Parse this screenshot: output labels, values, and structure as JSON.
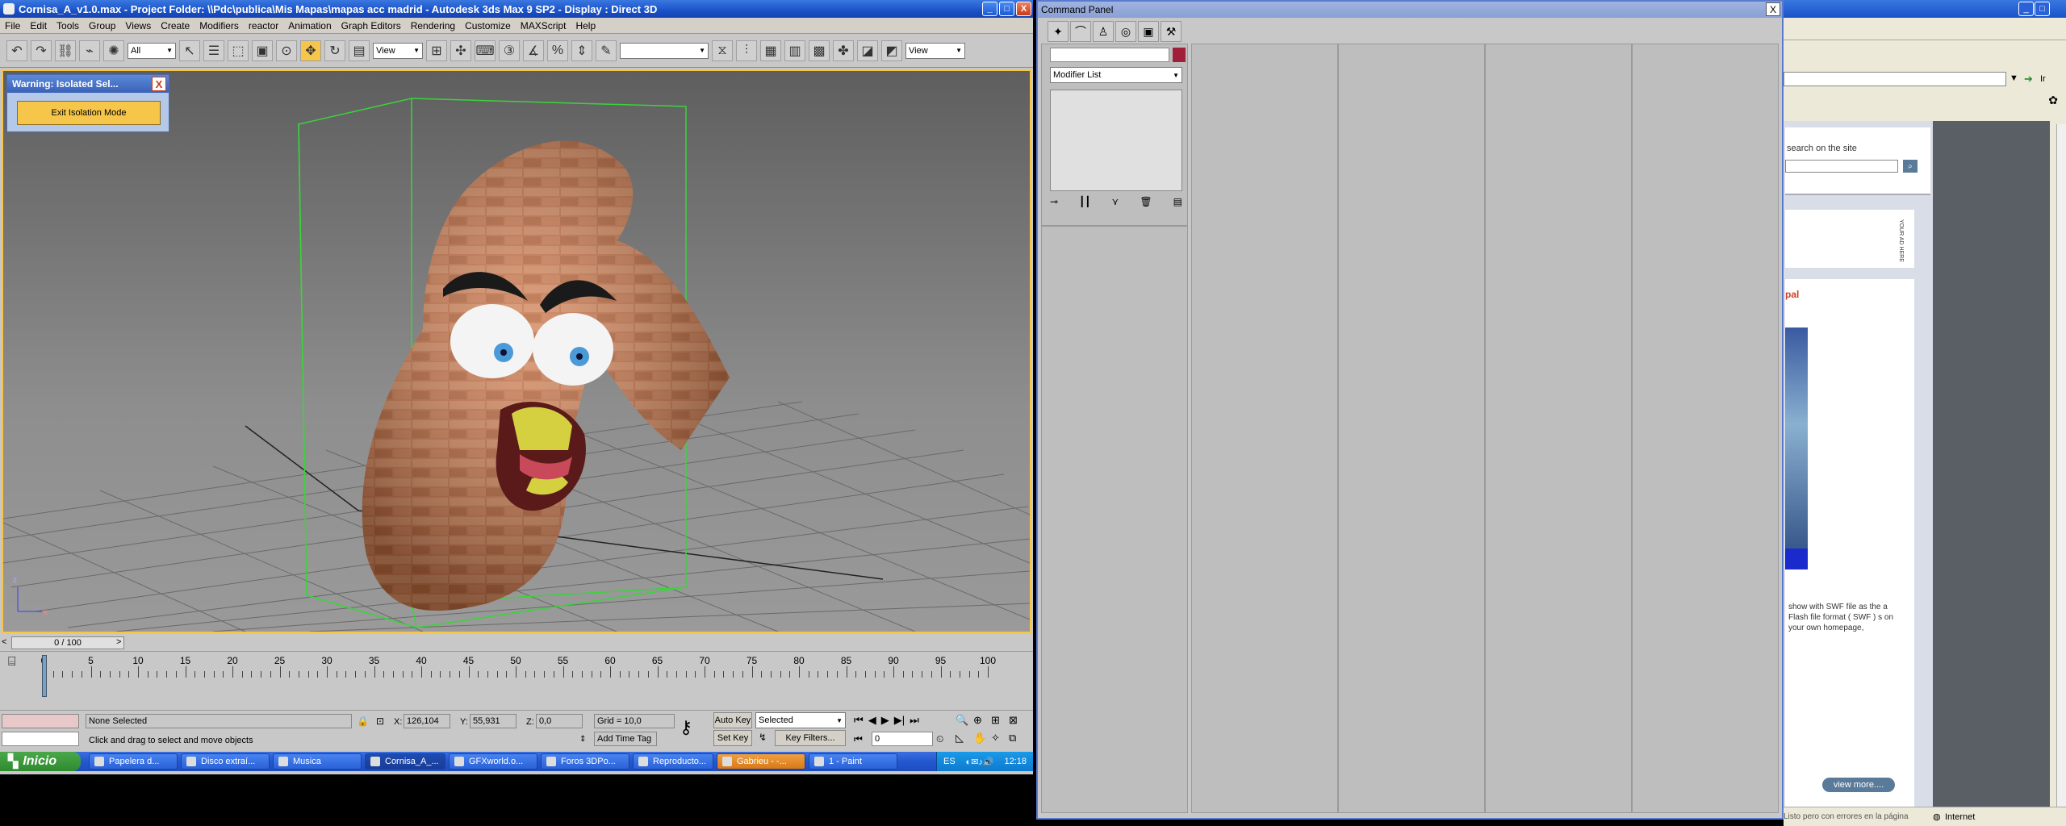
{
  "max": {
    "title": "Cornisa_A_v1.0.max      - Project Folder: \\\\Pdc\\publica\\Mis Mapas\\mapas acc madrid      - Autodesk 3ds Max 9 SP2      - Display : Direct 3D",
    "window_buttons": {
      "minimize": "_",
      "maximize": "□",
      "close": "X"
    },
    "menu": [
      "File",
      "Edit",
      "Tools",
      "Group",
      "Views",
      "Create",
      "Modifiers",
      "reactor",
      "Animation",
      "Graph Editors",
      "Rendering",
      "Customize",
      "MAXScript",
      "Help"
    ],
    "toolbar": {
      "filter_select": "All",
      "ref_coord_select": "View",
      "named_sel_select": "",
      "view_select": "View"
    },
    "isolation": {
      "title": "Warning: Isolated Sel...",
      "close": "X",
      "exit_button": "Exit Isolation Mode"
    },
    "timeline": {
      "slider_label": "0 / 100",
      "prev": "<",
      "next": ">",
      "ticks": [
        "0",
        "5",
        "10",
        "15",
        "20",
        "25",
        "30",
        "35",
        "40",
        "45",
        "50",
        "55",
        "60",
        "65",
        "70",
        "75",
        "80",
        "85",
        "90",
        "95",
        "100"
      ]
    },
    "status": {
      "selection": "None Selected",
      "prompt": "Click and drag to select and move objects",
      "x_label": "X:",
      "x_value": "126,104",
      "y_label": "Y:",
      "y_value": "55,931",
      "z_label": "Z:",
      "z_value": "0,0",
      "grid": "Grid = 10,0",
      "add_time_tag": "Add Time Tag",
      "auto_key": "Auto Key",
      "set_key": "Set Key",
      "key_mode": "Selected",
      "key_filters": "Key Filters...",
      "frame": "0"
    }
  },
  "taskbar": {
    "start": "Inicio",
    "tasks": [
      "Papelera d...",
      "Disco extraí...",
      "Musica",
      "Cornisa_A_...",
      "GFXworld.o...",
      "Foros 3DPo...",
      "Reproducto...",
      "Gabrieu - -...",
      "1 - Paint"
    ],
    "lang": "ES",
    "clock": "12:18"
  },
  "command_panel": {
    "title": "Command Panel",
    "close": "X",
    "modifier_list": "Modifier List",
    "accent_color": "#a0203a"
  },
  "browser": {
    "go_label": "Ir",
    "search_label": "search on the site",
    "ad_label": "YOUR AD HERE",
    "section_title": "pal",
    "description": "show with SWF file as the a Flash file format ( SWF ) s on your own homepage,",
    "view_more": "view more....",
    "status_left": "Listo pero con errores en la página",
    "status_right": "Internet"
  }
}
